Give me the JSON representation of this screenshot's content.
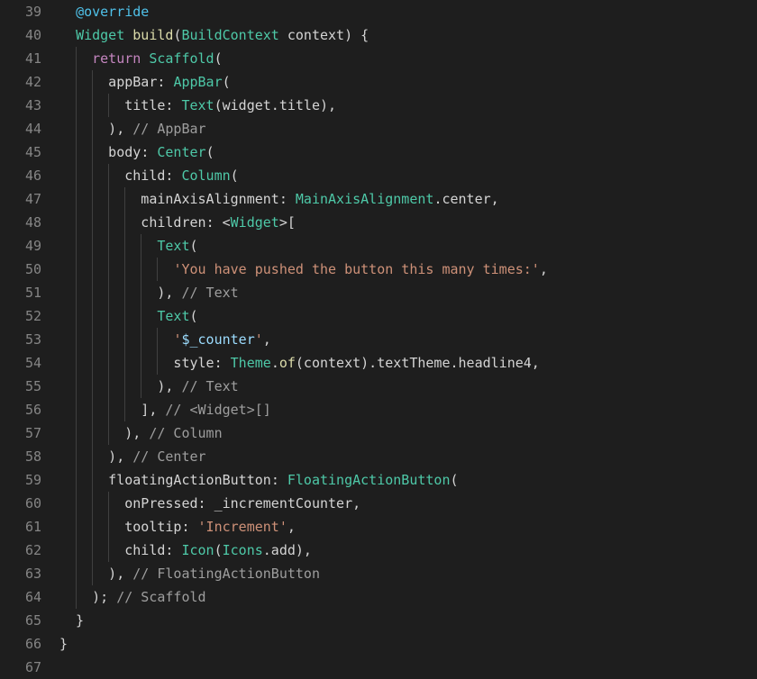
{
  "editor": {
    "name": "code-editor",
    "language": "Dart",
    "theme": "dark-plus",
    "background": "#1e1e1e",
    "gutter_color": "#858585",
    "indent_guide_color": "#404040",
    "font_size_px": 15,
    "line_height_px": 26,
    "first_line": 39,
    "last_line": 67,
    "colors": {
      "plain": "#d4d4d4",
      "annotation": "#4fc1e9",
      "type": "#4ec9a8",
      "function": "#dcdcaa",
      "keyword": "#c586c0",
      "string": "#ce9178",
      "interpolation": "#9cdcfe",
      "comment": "#9e9e9e"
    }
  },
  "lines": [
    {
      "number": "39",
      "indent": 2,
      "guides": [],
      "tokens": [
        {
          "text": "  ",
          "cls": "t-plain"
        },
        {
          "text": "@override",
          "cls": "t-anno"
        }
      ]
    },
    {
      "number": "40",
      "indent": 2,
      "guides": [],
      "tokens": [
        {
          "text": "  ",
          "cls": "t-plain"
        },
        {
          "text": "Widget",
          "cls": "t-type"
        },
        {
          "text": " ",
          "cls": "t-plain"
        },
        {
          "text": "build",
          "cls": "t-fn"
        },
        {
          "text": "(",
          "cls": "t-punct"
        },
        {
          "text": "BuildContext",
          "cls": "t-type"
        },
        {
          "text": " context",
          "cls": "t-plain"
        },
        {
          "text": ") {",
          "cls": "t-punct"
        }
      ]
    },
    {
      "number": "41",
      "indent": 4,
      "guides": [
        2
      ],
      "tokens": [
        {
          "text": "    ",
          "cls": "t-plain"
        },
        {
          "text": "return",
          "cls": "t-kw"
        },
        {
          "text": " ",
          "cls": "t-plain"
        },
        {
          "text": "Scaffold",
          "cls": "t-type"
        },
        {
          "text": "(",
          "cls": "t-punct"
        }
      ]
    },
    {
      "number": "42",
      "indent": 6,
      "guides": [
        2,
        4
      ],
      "tokens": [
        {
          "text": "      appBar",
          "cls": "t-plain"
        },
        {
          "text": ": ",
          "cls": "t-punct"
        },
        {
          "text": "AppBar",
          "cls": "t-type"
        },
        {
          "text": "(",
          "cls": "t-punct"
        }
      ]
    },
    {
      "number": "43",
      "indent": 8,
      "guides": [
        2,
        4,
        6
      ],
      "tokens": [
        {
          "text": "        title",
          "cls": "t-plain"
        },
        {
          "text": ": ",
          "cls": "t-punct"
        },
        {
          "text": "Text",
          "cls": "t-type"
        },
        {
          "text": "(widget.title),",
          "cls": "t-plain"
        }
      ]
    },
    {
      "number": "44",
      "indent": 6,
      "guides": [
        2,
        4
      ],
      "tokens": [
        {
          "text": "      ), ",
          "cls": "t-punct"
        },
        {
          "text": "// AppBar",
          "cls": "t-cmt"
        }
      ]
    },
    {
      "number": "45",
      "indent": 6,
      "guides": [
        2,
        4
      ],
      "tokens": [
        {
          "text": "      body",
          "cls": "t-plain"
        },
        {
          "text": ": ",
          "cls": "t-punct"
        },
        {
          "text": "Center",
          "cls": "t-type"
        },
        {
          "text": "(",
          "cls": "t-punct"
        }
      ]
    },
    {
      "number": "46",
      "indent": 8,
      "guides": [
        2,
        4,
        6
      ],
      "tokens": [
        {
          "text": "        child",
          "cls": "t-plain"
        },
        {
          "text": ": ",
          "cls": "t-punct"
        },
        {
          "text": "Column",
          "cls": "t-type"
        },
        {
          "text": "(",
          "cls": "t-punct"
        }
      ]
    },
    {
      "number": "47",
      "indent": 10,
      "guides": [
        2,
        4,
        6,
        8
      ],
      "tokens": [
        {
          "text": "          mainAxisAlignment",
          "cls": "t-plain"
        },
        {
          "text": ": ",
          "cls": "t-punct"
        },
        {
          "text": "MainAxisAlignment",
          "cls": "t-type"
        },
        {
          "text": ".center,",
          "cls": "t-plain"
        }
      ]
    },
    {
      "number": "48",
      "indent": 10,
      "guides": [
        2,
        4,
        6,
        8
      ],
      "tokens": [
        {
          "text": "          children",
          "cls": "t-plain"
        },
        {
          "text": ": <",
          "cls": "t-punct"
        },
        {
          "text": "Widget",
          "cls": "t-type"
        },
        {
          "text": ">[",
          "cls": "t-punct"
        }
      ]
    },
    {
      "number": "49",
      "indent": 12,
      "guides": [
        2,
        4,
        6,
        8,
        10
      ],
      "tokens": [
        {
          "text": "            ",
          "cls": "t-plain"
        },
        {
          "text": "Text",
          "cls": "t-type"
        },
        {
          "text": "(",
          "cls": "t-punct"
        }
      ]
    },
    {
      "number": "50",
      "indent": 14,
      "guides": [
        2,
        4,
        6,
        8,
        10,
        12
      ],
      "tokens": [
        {
          "text": "              ",
          "cls": "t-plain"
        },
        {
          "text": "'You have pushed the button this many times:'",
          "cls": "t-str"
        },
        {
          "text": ",",
          "cls": "t-punct"
        }
      ]
    },
    {
      "number": "51",
      "indent": 12,
      "guides": [
        2,
        4,
        6,
        8,
        10
      ],
      "tokens": [
        {
          "text": "            ), ",
          "cls": "t-punct"
        },
        {
          "text": "// Text",
          "cls": "t-cmt"
        }
      ]
    },
    {
      "number": "52",
      "indent": 12,
      "guides": [
        2,
        4,
        6,
        8,
        10
      ],
      "tokens": [
        {
          "text": "            ",
          "cls": "t-plain"
        },
        {
          "text": "Text",
          "cls": "t-type"
        },
        {
          "text": "(",
          "cls": "t-punct"
        }
      ]
    },
    {
      "number": "53",
      "indent": 14,
      "guides": [
        2,
        4,
        6,
        8,
        10,
        12
      ],
      "tokens": [
        {
          "text": "              ",
          "cls": "t-plain"
        },
        {
          "text": "'",
          "cls": "t-str"
        },
        {
          "text": "$_counter",
          "cls": "t-interp"
        },
        {
          "text": "'",
          "cls": "t-str"
        },
        {
          "text": ",",
          "cls": "t-punct"
        }
      ]
    },
    {
      "number": "54",
      "indent": 14,
      "guides": [
        2,
        4,
        6,
        8,
        10,
        12
      ],
      "tokens": [
        {
          "text": "              style",
          "cls": "t-plain"
        },
        {
          "text": ": ",
          "cls": "t-punct"
        },
        {
          "text": "Theme",
          "cls": "t-type"
        },
        {
          "text": ".",
          "cls": "t-punct"
        },
        {
          "text": "of",
          "cls": "t-fn"
        },
        {
          "text": "(context).textTheme.headline4,",
          "cls": "t-plain"
        }
      ]
    },
    {
      "number": "55",
      "indent": 12,
      "guides": [
        2,
        4,
        6,
        8,
        10
      ],
      "tokens": [
        {
          "text": "            ), ",
          "cls": "t-punct"
        },
        {
          "text": "// Text",
          "cls": "t-cmt"
        }
      ]
    },
    {
      "number": "56",
      "indent": 10,
      "guides": [
        2,
        4,
        6,
        8
      ],
      "tokens": [
        {
          "text": "          ], ",
          "cls": "t-punct"
        },
        {
          "text": "// <Widget>[]",
          "cls": "t-cmt"
        }
      ]
    },
    {
      "number": "57",
      "indent": 8,
      "guides": [
        2,
        4,
        6
      ],
      "tokens": [
        {
          "text": "        ), ",
          "cls": "t-punct"
        },
        {
          "text": "// Column",
          "cls": "t-cmt"
        }
      ]
    },
    {
      "number": "58",
      "indent": 6,
      "guides": [
        2,
        4
      ],
      "tokens": [
        {
          "text": "      ), ",
          "cls": "t-punct"
        },
        {
          "text": "// Center",
          "cls": "t-cmt"
        }
      ]
    },
    {
      "number": "59",
      "indent": 6,
      "guides": [
        2,
        4
      ],
      "tokens": [
        {
          "text": "      floatingActionButton",
          "cls": "t-plain"
        },
        {
          "text": ": ",
          "cls": "t-punct"
        },
        {
          "text": "FloatingActionButton",
          "cls": "t-type"
        },
        {
          "text": "(",
          "cls": "t-punct"
        }
      ]
    },
    {
      "number": "60",
      "indent": 8,
      "guides": [
        2,
        4,
        6
      ],
      "tokens": [
        {
          "text": "        onPressed",
          "cls": "t-plain"
        },
        {
          "text": ": ",
          "cls": "t-punct"
        },
        {
          "text": "_incrementCounter,",
          "cls": "t-plain"
        }
      ]
    },
    {
      "number": "61",
      "indent": 8,
      "guides": [
        2,
        4,
        6
      ],
      "tokens": [
        {
          "text": "        tooltip",
          "cls": "t-plain"
        },
        {
          "text": ": ",
          "cls": "t-punct"
        },
        {
          "text": "'Increment'",
          "cls": "t-str"
        },
        {
          "text": ",",
          "cls": "t-punct"
        }
      ]
    },
    {
      "number": "62",
      "indent": 8,
      "guides": [
        2,
        4,
        6
      ],
      "tokens": [
        {
          "text": "        child",
          "cls": "t-plain"
        },
        {
          "text": ": ",
          "cls": "t-punct"
        },
        {
          "text": "Icon",
          "cls": "t-type"
        },
        {
          "text": "(",
          "cls": "t-punct"
        },
        {
          "text": "Icons",
          "cls": "t-type"
        },
        {
          "text": ".add),",
          "cls": "t-plain"
        }
      ]
    },
    {
      "number": "63",
      "indent": 6,
      "guides": [
        2,
        4
      ],
      "tokens": [
        {
          "text": "      ), ",
          "cls": "t-punct"
        },
        {
          "text": "// FloatingActionButton",
          "cls": "t-cmt"
        }
      ]
    },
    {
      "number": "64",
      "indent": 4,
      "guides": [
        2
      ],
      "tokens": [
        {
          "text": "    ); ",
          "cls": "t-punct"
        },
        {
          "text": "// Scaffold",
          "cls": "t-cmt"
        }
      ]
    },
    {
      "number": "65",
      "indent": 2,
      "guides": [],
      "tokens": [
        {
          "text": "  }",
          "cls": "t-punct"
        }
      ]
    },
    {
      "number": "66",
      "indent": 0,
      "guides": [],
      "tokens": [
        {
          "text": "}",
          "cls": "t-punct"
        }
      ]
    },
    {
      "number": "67",
      "indent": 0,
      "guides": [],
      "tokens": []
    }
  ]
}
